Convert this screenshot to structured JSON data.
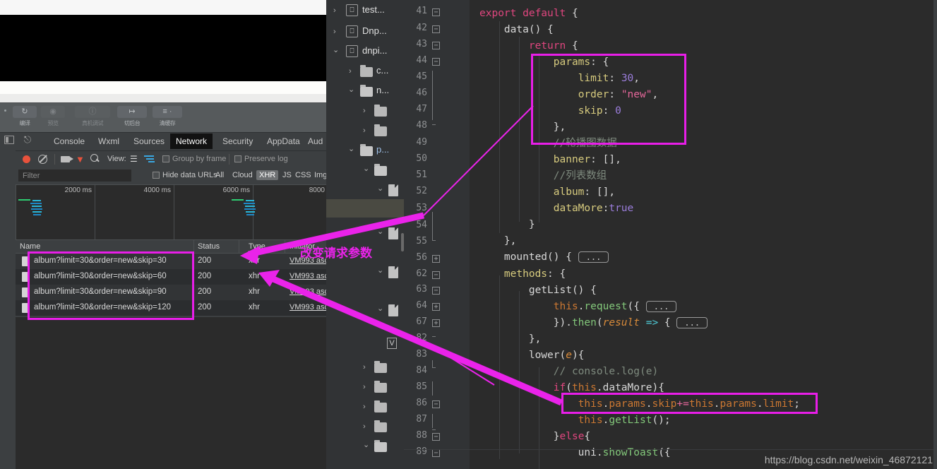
{
  "simulator": {
    "toolbar": [
      {
        "label": "编译",
        "icon": "refresh-icon",
        "glyph": "↻",
        "dim": false
      },
      {
        "label": "预览",
        "icon": "preview-eye-icon",
        "glyph": "◉",
        "dim": true
      },
      {
        "label": "真机调试",
        "icon": "device-debug-icon",
        "glyph": "ⓘ",
        "dim": true
      },
      {
        "label": "切后台",
        "icon": "background-switch-icon",
        "glyph": "↦",
        "dim": false
      },
      {
        "label": "清缓存",
        "icon": "clear-cache-icon",
        "glyph": "≣",
        "dim": false
      }
    ]
  },
  "devtools": {
    "tabs": [
      {
        "label": "Console",
        "active": false
      },
      {
        "label": "Wxml",
        "active": false
      },
      {
        "label": "Sources",
        "active": false
      },
      {
        "label": "Network",
        "active": true
      },
      {
        "label": "Security",
        "active": false
      },
      {
        "label": "AppData",
        "active": false
      },
      {
        "label": "Aud",
        "active": false
      }
    ],
    "network_toolbar": {
      "view_label": "View:",
      "group_by_frame": "Group by frame",
      "preserve_log": "Preserve log"
    },
    "filter_row": {
      "placeholder": "Filter",
      "value": "",
      "hide_data_urls": "Hide data URLs",
      "types": [
        {
          "label": "All",
          "selected": false
        },
        {
          "label": "Cloud",
          "selected": false
        },
        {
          "label": "XHR",
          "selected": true
        },
        {
          "label": "JS",
          "selected": false
        },
        {
          "label": "CSS",
          "selected": false
        },
        {
          "label": "Img",
          "selected": false
        }
      ]
    },
    "timeline": {
      "ticks": [
        "2000 ms",
        "4000 ms",
        "6000 ms",
        "8000"
      ]
    },
    "table": {
      "columns": [
        "Name",
        "Status",
        "Type",
        "Initiator"
      ],
      "rows": [
        {
          "name": "album?limit=30&order=new&skip=30",
          "status": "200",
          "type": "xhr",
          "initiator": "VM993 asc"
        },
        {
          "name": "album?limit=30&order=new&skip=60",
          "status": "200",
          "type": "xhr",
          "initiator": "VM993 asc"
        },
        {
          "name": "album?limit=30&order=new&skip=90",
          "status": "200",
          "type": "xhr",
          "initiator": "VM993 asc"
        },
        {
          "name": "album?limit=30&order=new&skip=120",
          "status": "200",
          "type": "xhr",
          "initiator": "VM993 asc"
        }
      ]
    }
  },
  "file_tree": [
    {
      "label": "test...",
      "kind": "module",
      "arrow": "collapsed",
      "depth": 0,
      "selected": false
    },
    {
      "label": "Dnp...",
      "kind": "module",
      "arrow": "collapsed",
      "depth": 0,
      "selected": false
    },
    {
      "label": "dnpi...",
      "kind": "module",
      "arrow": "expanded",
      "depth": 0,
      "selected": false
    },
    {
      "label": "c...",
      "kind": "folder",
      "arrow": "collapsed",
      "depth": 1,
      "selected": false
    },
    {
      "label": "n...",
      "kind": "folder",
      "arrow": "expanded",
      "depth": 1,
      "selected": false
    },
    {
      "label": "",
      "kind": "folder",
      "arrow": "collapsed",
      "depth": 2,
      "selected": false
    },
    {
      "label": "",
      "kind": "folder",
      "arrow": "collapsed",
      "depth": 2,
      "selected": false
    },
    {
      "label": "p...",
      "kind": "folder",
      "arrow": "expanded",
      "depth": 1,
      "selected": false,
      "blue": true
    },
    {
      "label": "",
      "kind": "folder",
      "arrow": "expanded",
      "depth": 2,
      "selected": false
    },
    {
      "label": "",
      "kind": "file",
      "arrow": "expanded",
      "depth": 3,
      "selected": false
    },
    {
      "label": "",
      "kind": "none",
      "arrow": "none",
      "depth": 3,
      "selected": true
    },
    {
      "label": "",
      "kind": "file",
      "arrow": "expanded",
      "depth": 3,
      "selected": false
    },
    {
      "label": "",
      "kind": "file",
      "arrow": "expanded",
      "depth": 3,
      "selected": false
    },
    {
      "label": "",
      "kind": "marker",
      "arrow": "none",
      "depth": 3,
      "selected": false
    },
    {
      "label": "",
      "kind": "folder",
      "arrow": "collapsed",
      "depth": 2,
      "selected": false
    },
    {
      "label": "",
      "kind": "folder",
      "arrow": "collapsed",
      "depth": 2,
      "selected": false
    },
    {
      "label": "",
      "kind": "folder",
      "arrow": "collapsed",
      "depth": 2,
      "selected": false
    },
    {
      "label": "",
      "kind": "folder",
      "arrow": "collapsed",
      "depth": 2,
      "selected": false
    },
    {
      "label": "",
      "kind": "folder",
      "arrow": "expanded",
      "depth": 2,
      "selected": false
    }
  ],
  "editor": {
    "line_numbers": [
      "41",
      "42",
      "43",
      "44",
      "45",
      "46",
      "47",
      "48",
      "49",
      "50",
      "51",
      "52",
      "53",
      "54",
      "55",
      "56",
      "62",
      "63",
      "64",
      "67",
      "82",
      "83",
      "84",
      "85",
      "86",
      "87",
      "88",
      "89"
    ],
    "folded_placeholder": "...",
    "lines": [
      "export default {",
      "    data() {",
      "        return {",
      "            params: {",
      "                limit: 30,",
      "                order: \"new\",",
      "                skip: 0",
      "            },",
      "            //轮播图数据",
      "            banner: [],",
      "            //列表数组",
      "            album: [],",
      "            dataMore:true",
      "        }",
      "    },",
      "    mounted() { ... }",
      "    methods: {",
      "        getList() {",
      "            this.request({ ... }",
      "            }).then(result => { ... }",
      "        },",
      "        lower(e){",
      "            // console.log(e)",
      "            if(this.dataMore){",
      "                this.params.skip+=this.params.limit;",
      "                this.getList();",
      "            }else{",
      "                uni.showToast({"
    ]
  },
  "annotations": {
    "label": "改变请求参数",
    "color": "#ea23ea",
    "highlight_boxes": [
      "params-object",
      "network-rows",
      "skip-increment-line"
    ]
  },
  "watermark": "https://blog.csdn.net/weixin_46872121"
}
